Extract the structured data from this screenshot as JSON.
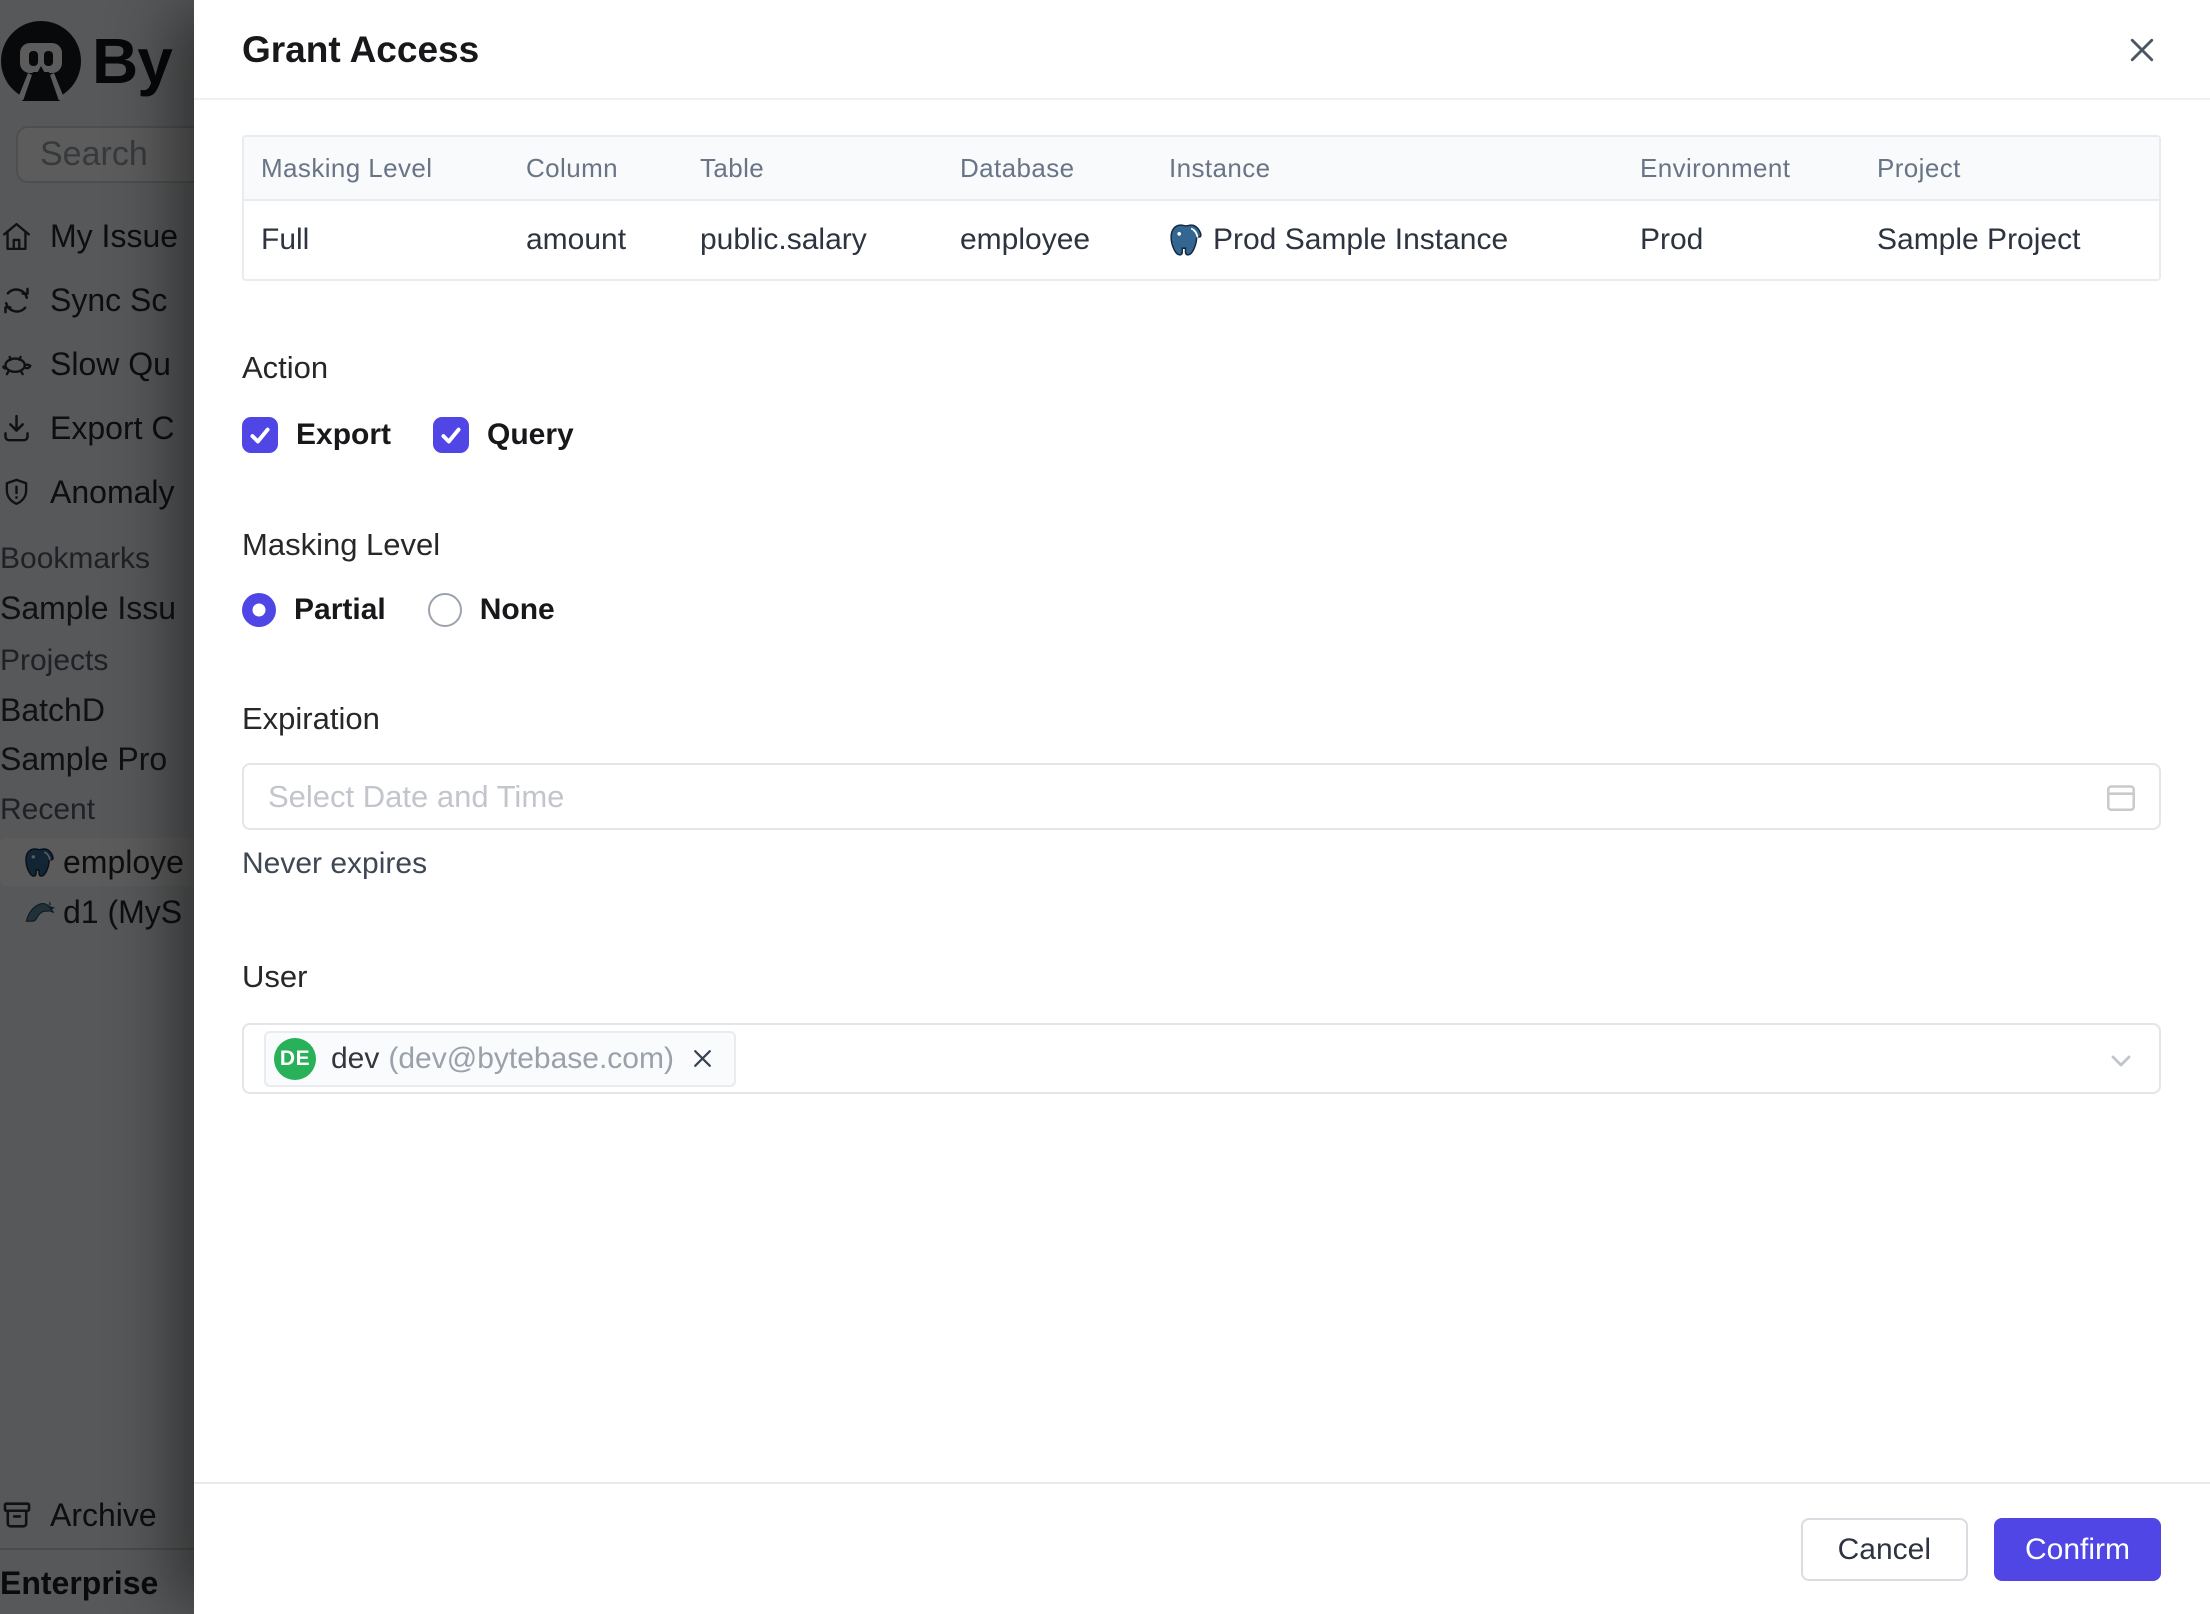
{
  "colors": {
    "accent": "#4f46e5",
    "avatar_green": "#28b159",
    "pg_blue": "#336791",
    "mysql_blue": "#5d87a1"
  },
  "sidebar": {
    "logo_text": "By",
    "search_placeholder": "Search",
    "nav_items": [
      {
        "label": "My Issue",
        "icon": "home-icon"
      },
      {
        "label": "Sync Sc",
        "icon": "sync-icon"
      },
      {
        "label": "Slow Qu",
        "icon": "turtle-icon"
      },
      {
        "label": "Export C",
        "icon": "download-icon"
      },
      {
        "label": "Anomaly",
        "icon": "shield-icon"
      }
    ],
    "sections": [
      {
        "title": "Bookmarks",
        "items": [
          {
            "label": "Sample Issu"
          }
        ]
      },
      {
        "title": "Projects",
        "items": [
          {
            "label": "BatchD"
          },
          {
            "label": "Sample Pro"
          }
        ]
      },
      {
        "title": "Recent",
        "items": [
          {
            "label": "employe",
            "icon": "postgresql-icon",
            "selected": true
          },
          {
            "label": "d1 (MyS",
            "icon": "mysql-icon",
            "selected": false
          }
        ]
      }
    ],
    "archive_label": "Archive",
    "enterprise_label": "Enterprise"
  },
  "modal": {
    "title": "Grant Access",
    "table": {
      "headers": [
        "Masking Level",
        "Column",
        "Table",
        "Database",
        "Instance",
        "Environment",
        "Project"
      ],
      "row": {
        "masking_level": "Full",
        "column": "amount",
        "table": "public.salary",
        "database": "employee",
        "instance": "Prod Sample Instance",
        "environment": "Prod",
        "project": "Sample Project"
      }
    },
    "action": {
      "heading": "Action",
      "options": [
        {
          "label": "Export",
          "checked": true
        },
        {
          "label": "Query",
          "checked": true
        }
      ]
    },
    "masking": {
      "heading": "Masking Level",
      "options": [
        {
          "label": "Partial",
          "selected": true
        },
        {
          "label": "None",
          "selected": false
        }
      ]
    },
    "expiration": {
      "heading": "Expiration",
      "placeholder": "Select Date and Time",
      "note": "Never expires"
    },
    "user": {
      "heading": "User",
      "selected": {
        "avatar_initials": "DE",
        "name": "dev",
        "email": "(dev@bytebase.com)"
      }
    },
    "footer": {
      "cancel_label": "Cancel",
      "confirm_label": "Confirm"
    }
  }
}
